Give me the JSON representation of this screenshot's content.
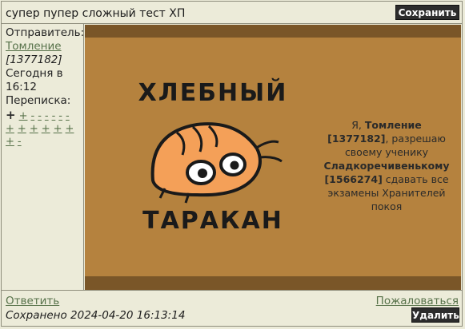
{
  "header": {
    "title": "супер пупер сложный тест ХП",
    "save_label": "Сохранить"
  },
  "sidebar": {
    "sender_label": "Отправитель:",
    "sender_name": "Томление",
    "sender_id": "[1377182]",
    "date_text": "Сегодня в",
    "time_text": "16:12",
    "correspondence_label": "Переписка:",
    "pages": [
      "+",
      "+",
      "-",
      "-",
      "-",
      "-",
      "-",
      "-",
      "+",
      "+",
      "+",
      "+",
      "+",
      "+",
      "+",
      "-"
    ]
  },
  "content": {
    "sticker_line1": "ХЛЕБНЫЙ",
    "sticker_line2": "ТАРАКАН",
    "note_prefix": "Я, ",
    "note_name": "Томление",
    "note_id": "[1377182]",
    "note_mid": ", разрешаю своему ученику ",
    "note_student": "Сладкоречивенькому",
    "note_student_id": "[1566274]",
    "note_end": " сдавать все экзамены Хранителей покоя"
  },
  "footer": {
    "reply_label": "Ответить",
    "report_label": "Пожаловаться",
    "saved_text": "Сохранено 2024-04-20 16:13:14",
    "delete_label": "Удалить"
  },
  "colors": {
    "page_bg": "#ecebd9",
    "content_bg": "#b5823e",
    "band": "#7a5628",
    "link": "#57724a",
    "button": "#2c2c2c",
    "bug_body": "#f4a058"
  }
}
